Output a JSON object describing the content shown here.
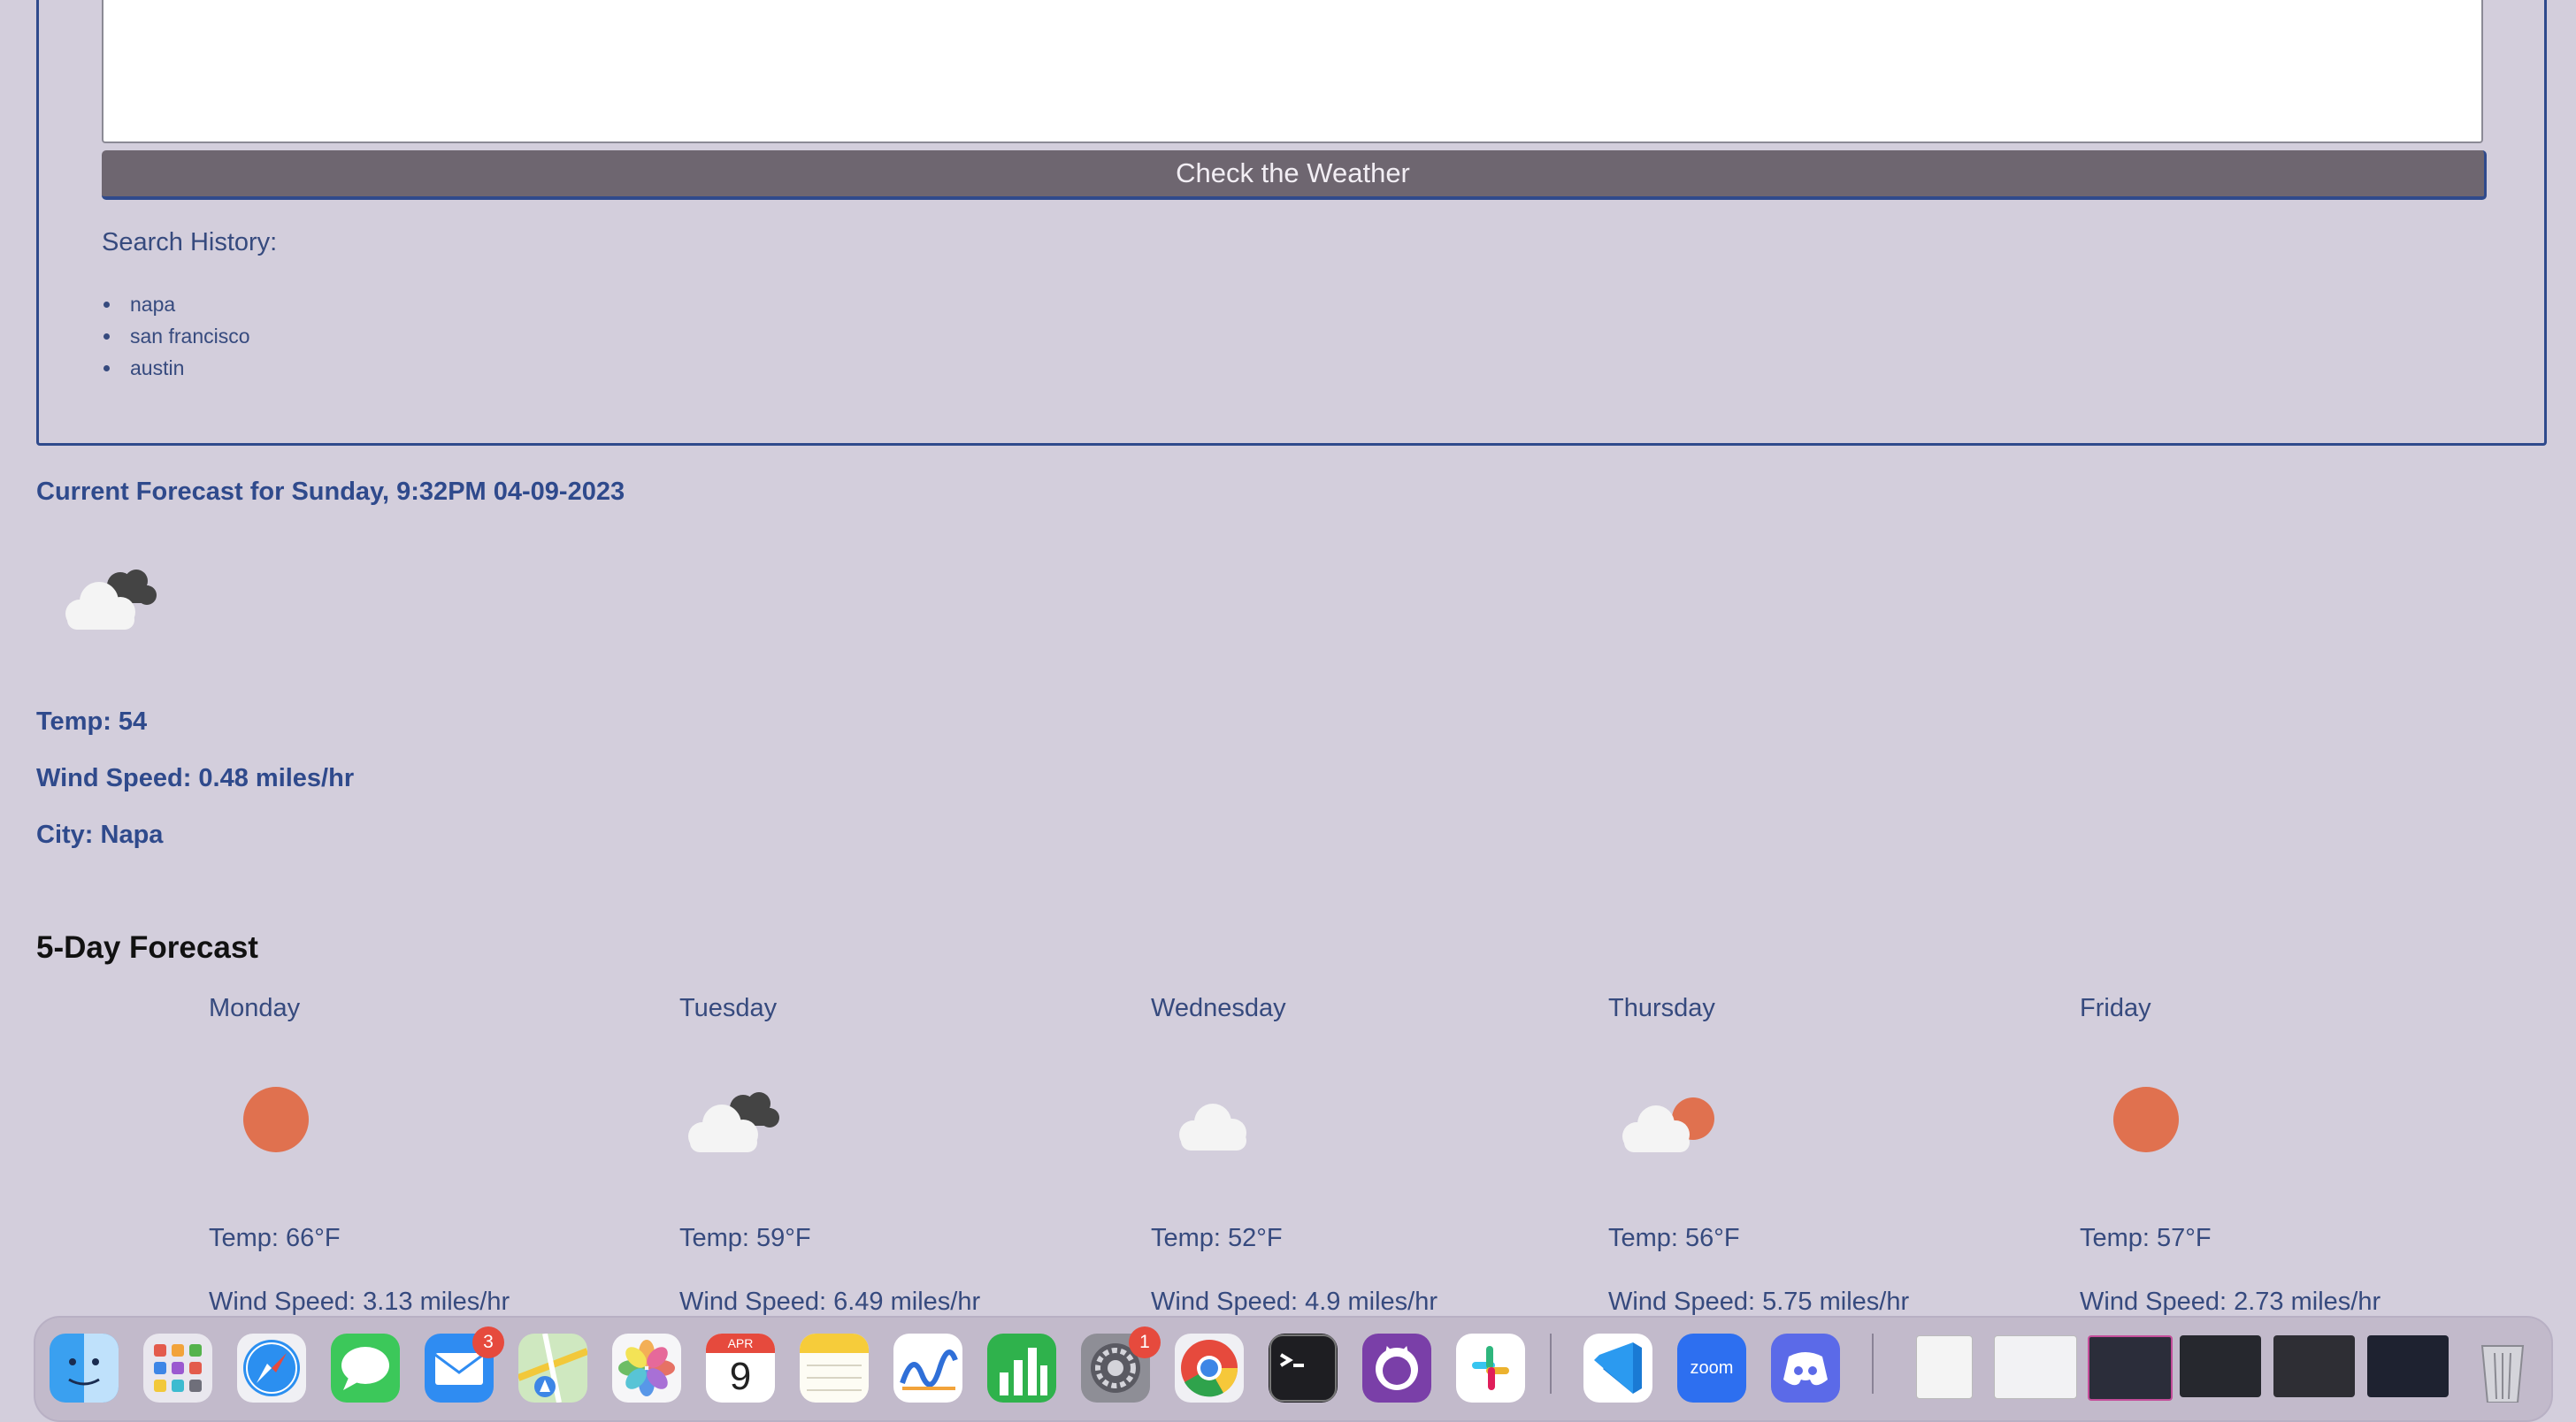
{
  "search": {
    "button_label": "Check the Weather",
    "history_title": "Search History:",
    "history": [
      "napa",
      "san francisco",
      "austin"
    ]
  },
  "current": {
    "title": "Current Forecast for Sunday, 9:32PM 04-09-2023",
    "icon": "partly-cloudy-night-icon",
    "temp": "Temp: 54",
    "wind": "Wind Speed: 0.48 miles/hr",
    "city": "City: Napa"
  },
  "forecast": {
    "title": "5-Day Forecast",
    "days": [
      {
        "day": "Monday",
        "icon": "sun-icon",
        "temp": "Temp: 66°F",
        "wind": "Wind Speed: 3.13 miles/hr"
      },
      {
        "day": "Tuesday",
        "icon": "dark-clouds-icon",
        "temp": "Temp: 59°F",
        "wind": "Wind Speed: 6.49 miles/hr"
      },
      {
        "day": "Wednesday",
        "icon": "cloud-icon",
        "temp": "Temp: 52°F",
        "wind": "Wind Speed: 4.9 miles/hr"
      },
      {
        "day": "Thursday",
        "icon": "partly-sunny-icon",
        "temp": "Temp: 56°F",
        "wind": "Wind Speed: 5.75 miles/hr"
      },
      {
        "day": "Friday",
        "icon": "sun-icon",
        "temp": "Temp: 57°F",
        "wind": "Wind Speed: 2.73 miles/hr"
      }
    ]
  },
  "dock": {
    "mail_badge": "3",
    "calendar_month": "APR",
    "calendar_day": "9",
    "settings_badge": "1",
    "zoom_label": "zoom"
  },
  "colors": {
    "background": "#d3cedc",
    "accent": "#2f4a8c",
    "sun": "#e0714f",
    "button": "#6e6670"
  }
}
